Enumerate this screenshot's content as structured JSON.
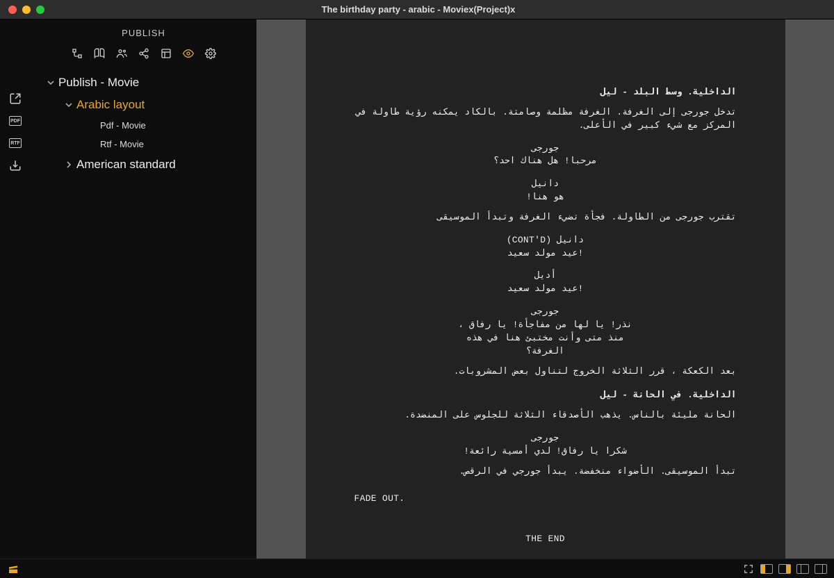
{
  "window": {
    "title": "The birthday party - arabic - Moviex(Project)x"
  },
  "sidebar": {
    "title": "PUBLISH",
    "tree": {
      "root_label": "Publish - Movie",
      "arabic_layout_label": "Arabic layout",
      "pdf_label": "Pdf - Movie",
      "rtf_label": "Rtf - Movie",
      "american_label": "American standard"
    }
  },
  "rail": {
    "pdf_badge": "PDF",
    "rtf_badge": "RTF"
  },
  "script": {
    "scene1_heading": "الداخلية. وسط البلد - ليل",
    "action1": "تدخل جورجى إلى الغرفة. الغرفة مظلمة وصامتة. بالكاد يمكنه رؤية طاولة في المركز مع شيء كبير في الأعلى.",
    "char_georgi": "جورجى",
    "dialog_georgi_1": "مرحبا! هل هناك احد؟",
    "char_daniel": "دانيل",
    "dialog_daniel_1": "هو هنا!",
    "action2": "تقترب جورجى من الطاولة. فجأة تضيء الغرفة وتبدأ الموسيقى",
    "char_daniel_contd": "دانيل (CONT'D)",
    "dialog_daniel_2": "!عيد مولد سعيد",
    "char_adele": "أديل",
    "dialog_adele_1": "!عيد مولد سعيد",
    "dialog_georgi_2": "نذر! يا لها من مفاجأة! يا رفاق ، منذ متى وأنت مختبئ هنا في هذه الغرفة؟",
    "action3": "بعد الكعكة ، قرر الثلاثة الخروج لتناول بعض المشروبات.",
    "scene2_heading": "الداخلية. في الحانة - ليل",
    "action4": "الحانة مليئة بالناس. يذهب الأصدقاء الثلاثة للجلوس على المنضدة.",
    "dialog_georgi_3": "شكرا يا رفاق! لدي أمسية رائعة!",
    "action5": "تبدأ الموسيقى. الأضواء منخفضة. يبدأ جورجي في الرقص.",
    "fade_out": "FADE OUT.",
    "the_end": "THE END"
  }
}
